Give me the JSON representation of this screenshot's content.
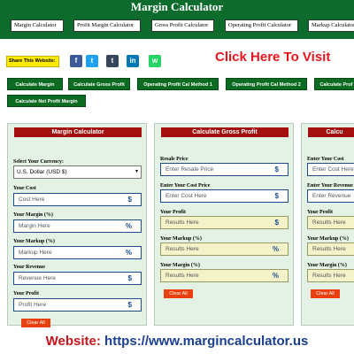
{
  "header": {
    "title": "Margin Calculator",
    "nav": [
      "Margin Calculator",
      "Profit Margin Calculator",
      "Gross Profit Calculator",
      "Operating Profit Calculator",
      "Markup Calculator"
    ]
  },
  "share": {
    "label": "Share This Website:",
    "icons": [
      {
        "name": "facebook-icon",
        "glyph": "f",
        "color": "#3b5998"
      },
      {
        "name": "twitter-icon",
        "glyph": "t",
        "color": "#1da1f2"
      },
      {
        "name": "tumblr-icon",
        "glyph": "t",
        "color": "#35465c"
      },
      {
        "name": "linkedin-icon",
        "glyph": "in",
        "color": "#0077b5"
      },
      {
        "name": "whatsapp-icon",
        "glyph": "w",
        "color": "#25d366"
      }
    ]
  },
  "banner": {
    "visit_text": "Click Here To Visit"
  },
  "calc_buttons": [
    "Calculate Margin",
    "Calculate Gross Profit",
    "Operating Profit Cal Method 1",
    "Operating Profit Cal Method 2",
    "Calculate Prof",
    "Calculate Net Profit Margin"
  ],
  "panels": {
    "margin": {
      "title": "Margin Calculator",
      "currency_label": "Select Your Currency:",
      "currency_value": "U.S. Dollar (USD $)",
      "fields": [
        {
          "label": "Your Cost",
          "placeholder": "Cost Here",
          "symbol": "$"
        },
        {
          "label": "Your Margin (%)",
          "placeholder": "Margin Here",
          "symbol": "%"
        },
        {
          "label": "Your Markup (%)",
          "placeholder": "Markup Here",
          "symbol": "%"
        },
        {
          "label": "Your Revenue",
          "placeholder": "Revenue Here",
          "symbol": "$"
        },
        {
          "label": "Your Profit",
          "placeholder": "Profit Here",
          "symbol": "$"
        }
      ],
      "clear": "Clear All"
    },
    "gross": {
      "title": "Calculate Gross Profit",
      "fields": [
        {
          "label": "Resale Price",
          "placeholder": "Enter Resale Price",
          "symbol": "$"
        },
        {
          "label": "Enter Your Cost Price",
          "placeholder": "Enter Cost Here",
          "symbol": "$"
        },
        {
          "label": "Your Profit",
          "placeholder": "Results Here",
          "symbol": "$"
        },
        {
          "label": "Your Markup (%)",
          "placeholder": "Results Here",
          "symbol": "%"
        },
        {
          "label": "Your Margin (%)",
          "placeholder": "Results Here",
          "symbol": "%"
        }
      ],
      "clear": "Clear All"
    },
    "third": {
      "title": "Calcu",
      "fields": [
        {
          "label": "Enter Your Cost",
          "placeholder": "Enter Cost Here",
          "symbol": ""
        },
        {
          "label": "Enter Your Revenue",
          "placeholder": "Enter Revenue",
          "symbol": ""
        },
        {
          "label": "Your Profit",
          "placeholder": "Results Here",
          "symbol": ""
        },
        {
          "label": "Your Markup (%)",
          "placeholder": "Results Here",
          "symbol": ""
        },
        {
          "label": "Your Margin (%)",
          "placeholder": "Results Here",
          "symbol": ""
        }
      ],
      "clear": "Clear All"
    }
  },
  "footer": {
    "website_label": "Website:",
    "website_url": "https://www.margincalculator.us"
  }
}
